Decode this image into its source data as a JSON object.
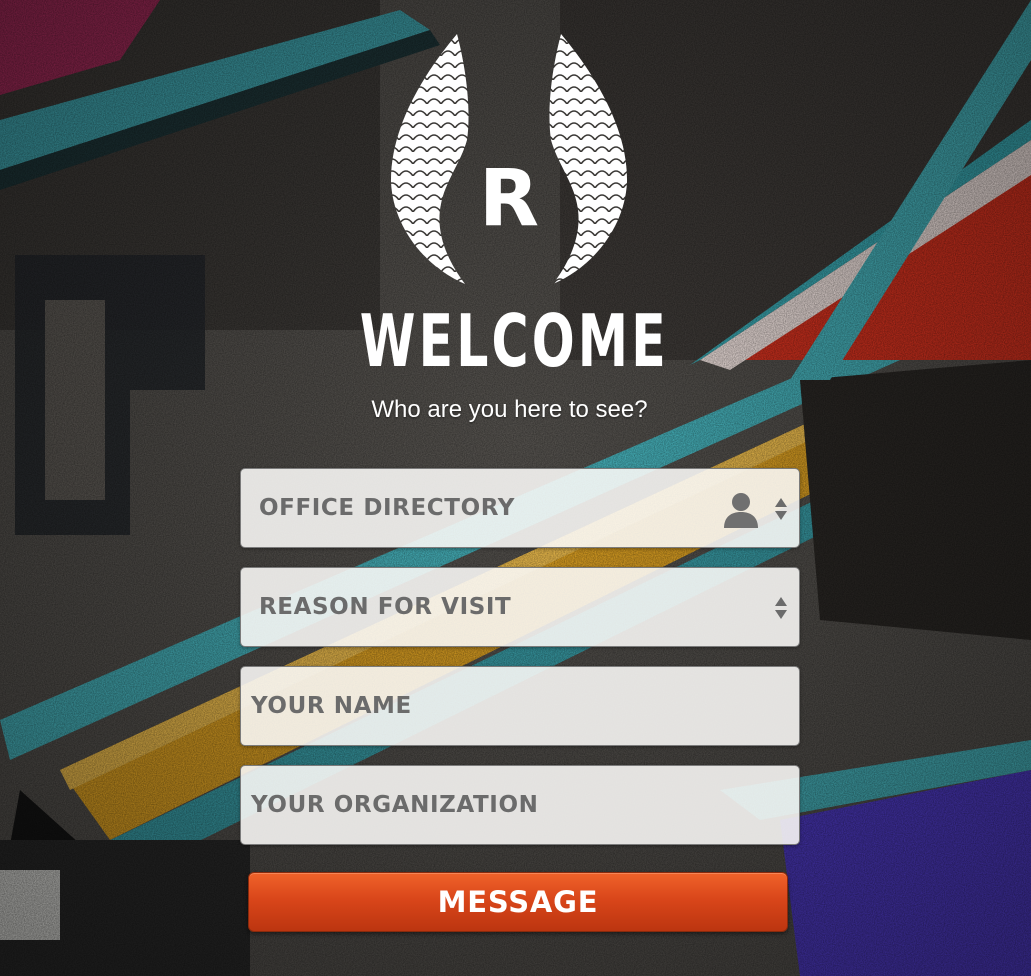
{
  "brand": {
    "logo_letter": "R",
    "welcome_title": "WELCOME",
    "subtitle": "Who are you here to see?"
  },
  "form": {
    "office_directory": {
      "label": "OFFICE DIRECTORY",
      "icon": "person-icon"
    },
    "reason_for_visit": {
      "label": "REASON FOR VISIT"
    },
    "your_name": {
      "placeholder": "YOUR NAME"
    },
    "your_organization": {
      "placeholder": "YOUR ORGANIZATION"
    },
    "submit_label": "MESSAGE"
  },
  "colors": {
    "button": "#d9461a",
    "field_bg": "#fcfbf8",
    "field_text": "#6b6b6b"
  }
}
